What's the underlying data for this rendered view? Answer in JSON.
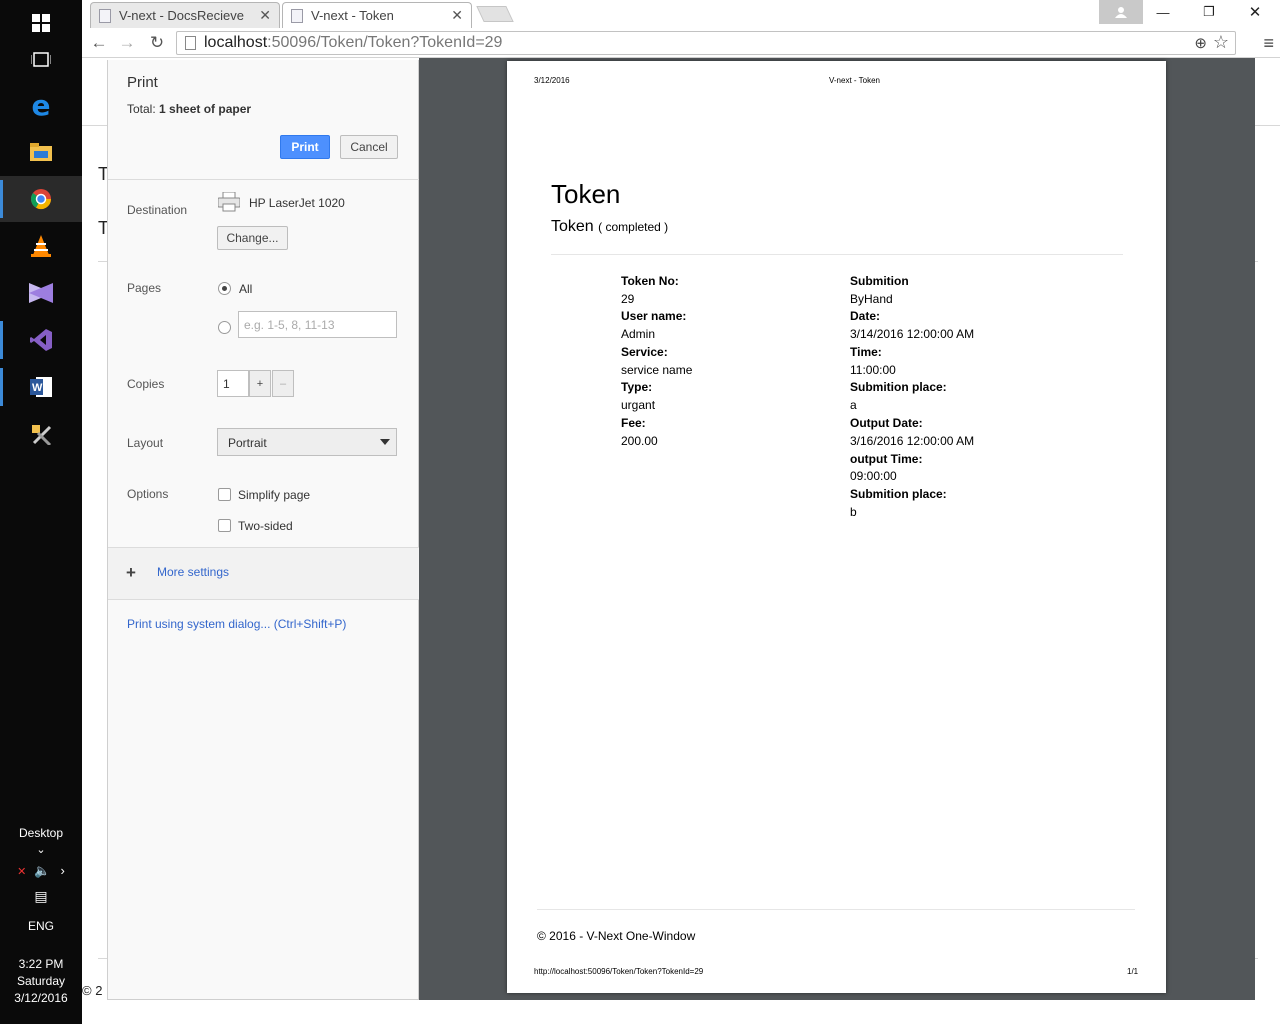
{
  "tabs": [
    {
      "title": "V-next - DocsRecieve",
      "active": false
    },
    {
      "title": "V-next - Token",
      "active": true
    }
  ],
  "address": {
    "host": "localhost",
    "path": ":50096/Token/Token?TokenId=29"
  },
  "taskbar": {
    "desktop_label": "Desktop",
    "language": "ENG",
    "time": "3:22 PM",
    "day": "Saturday",
    "date": "3/12/2016",
    "icons": [
      "windows-start-icon",
      "task-view-icon",
      "edge-icon",
      "file-explorer-icon",
      "chrome-icon",
      "vlc-icon",
      "visual-studio-icon",
      "visual-studio-alt-icon",
      "word-icon",
      "tools-icon"
    ]
  },
  "print": {
    "title": "Print",
    "total_label": "Total:",
    "total_value": "1 sheet of paper",
    "print_button": "Print",
    "cancel_button": "Cancel",
    "destination_label": "Destination",
    "destination_value": "HP LaserJet 1020",
    "change_button": "Change...",
    "pages_label": "Pages",
    "pages_all": "All",
    "pages_placeholder": "e.g. 1-5, 8, 11-13",
    "copies_label": "Copies",
    "copies_value": "1",
    "copies_plus": "+",
    "copies_minus": "–",
    "layout_label": "Layout",
    "layout_value": "Portrait",
    "options_label": "Options",
    "option_simplify": "Simplify page",
    "option_two_sided": "Two-sided",
    "more_settings": "More settings",
    "system_dialog": "Print using system dialog... (Ctrl+Shift+P)"
  },
  "page": {
    "header_date": "3/12/2016",
    "header_title": "V-next - Token",
    "heading": "Token",
    "subheading": "Token",
    "status": "( completed )",
    "left_fields": [
      {
        "label": "Token No:",
        "value": "29"
      },
      {
        "label": "User name:",
        "value": "Admin"
      },
      {
        "label": "Service:",
        "value": "service name"
      },
      {
        "label": "Type:",
        "value": "urgant"
      },
      {
        "label": "Fee:",
        "value": "200.00"
      }
    ],
    "right_fields": [
      {
        "label": "Submition",
        "value": "ByHand"
      },
      {
        "label": "Date:",
        "value": "3/14/2016 12:00:00 AM"
      },
      {
        "label": "Time:",
        "value": "11:00:00"
      },
      {
        "label": "Submition place:",
        "value": "a"
      },
      {
        "label": "Output Date:",
        "value": "3/16/2016 12:00:00 AM"
      },
      {
        "label": "output Time:",
        "value": "09:00:00"
      },
      {
        "label": "Submition place:",
        "value": "b"
      }
    ],
    "footer": "© 2016 - V-Next One-Window",
    "footer_url": "http://localhost:50096/Token/Token?TokenId=29",
    "page_number": "1/1"
  },
  "background": {
    "t1": "T",
    "t2": "T",
    "copyright": "© 2"
  },
  "colors": {
    "accent": "#4d90fe",
    "link": "#3366cc",
    "preview_bg": "#525659",
    "taskbar": "#0a0a0a"
  }
}
